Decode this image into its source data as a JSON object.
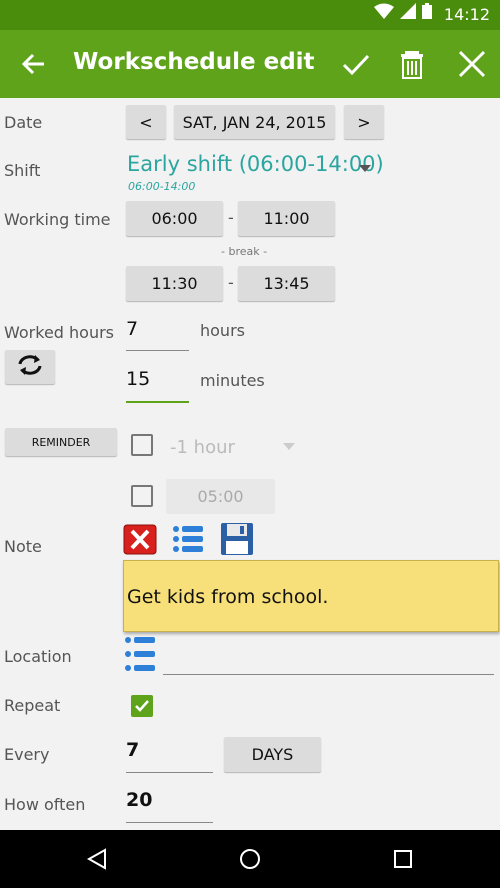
{
  "status_bar": {
    "time": "14:12"
  },
  "app_bar": {
    "title": "Workschedule edit"
  },
  "form": {
    "date": {
      "label": "Date",
      "prev": "<",
      "value": "SAT, JAN 24, 2015",
      "next": ">"
    },
    "shift": {
      "label": "Shift",
      "value": "Early shift (06:00-14:00)",
      "sub": "06:00-14:00"
    },
    "working_time": {
      "label": "Working time",
      "start": "06:00",
      "end": "11:00",
      "break_label": "- break -",
      "break_start": "11:30",
      "break_end": "13:45",
      "dash": "-"
    },
    "worked_hours": {
      "label": "Worked hours",
      "hours": "7",
      "hours_unit": "hours",
      "minutes": "15",
      "minutes_unit": "minutes"
    },
    "reminder": {
      "button": "REMINDER",
      "offset": "-1 hour",
      "time": "05:00",
      "checked_offset": false,
      "checked_time": false
    },
    "note": {
      "label": "Note",
      "text": "Get kids from school."
    },
    "location": {
      "label": "Location",
      "value": ""
    },
    "repeat": {
      "label": "Repeat",
      "checked": true
    },
    "every": {
      "label": "Every",
      "value": "7",
      "unit_button": "DAYS"
    },
    "how_often": {
      "label": "How often",
      "value": "20"
    }
  },
  "colors": {
    "statusbar": "#4a8c0c",
    "appbar": "#5fa31b",
    "accent": "#5fa31b",
    "shift_text": "#2aa5a0",
    "note_bg": "#f7e07a"
  }
}
